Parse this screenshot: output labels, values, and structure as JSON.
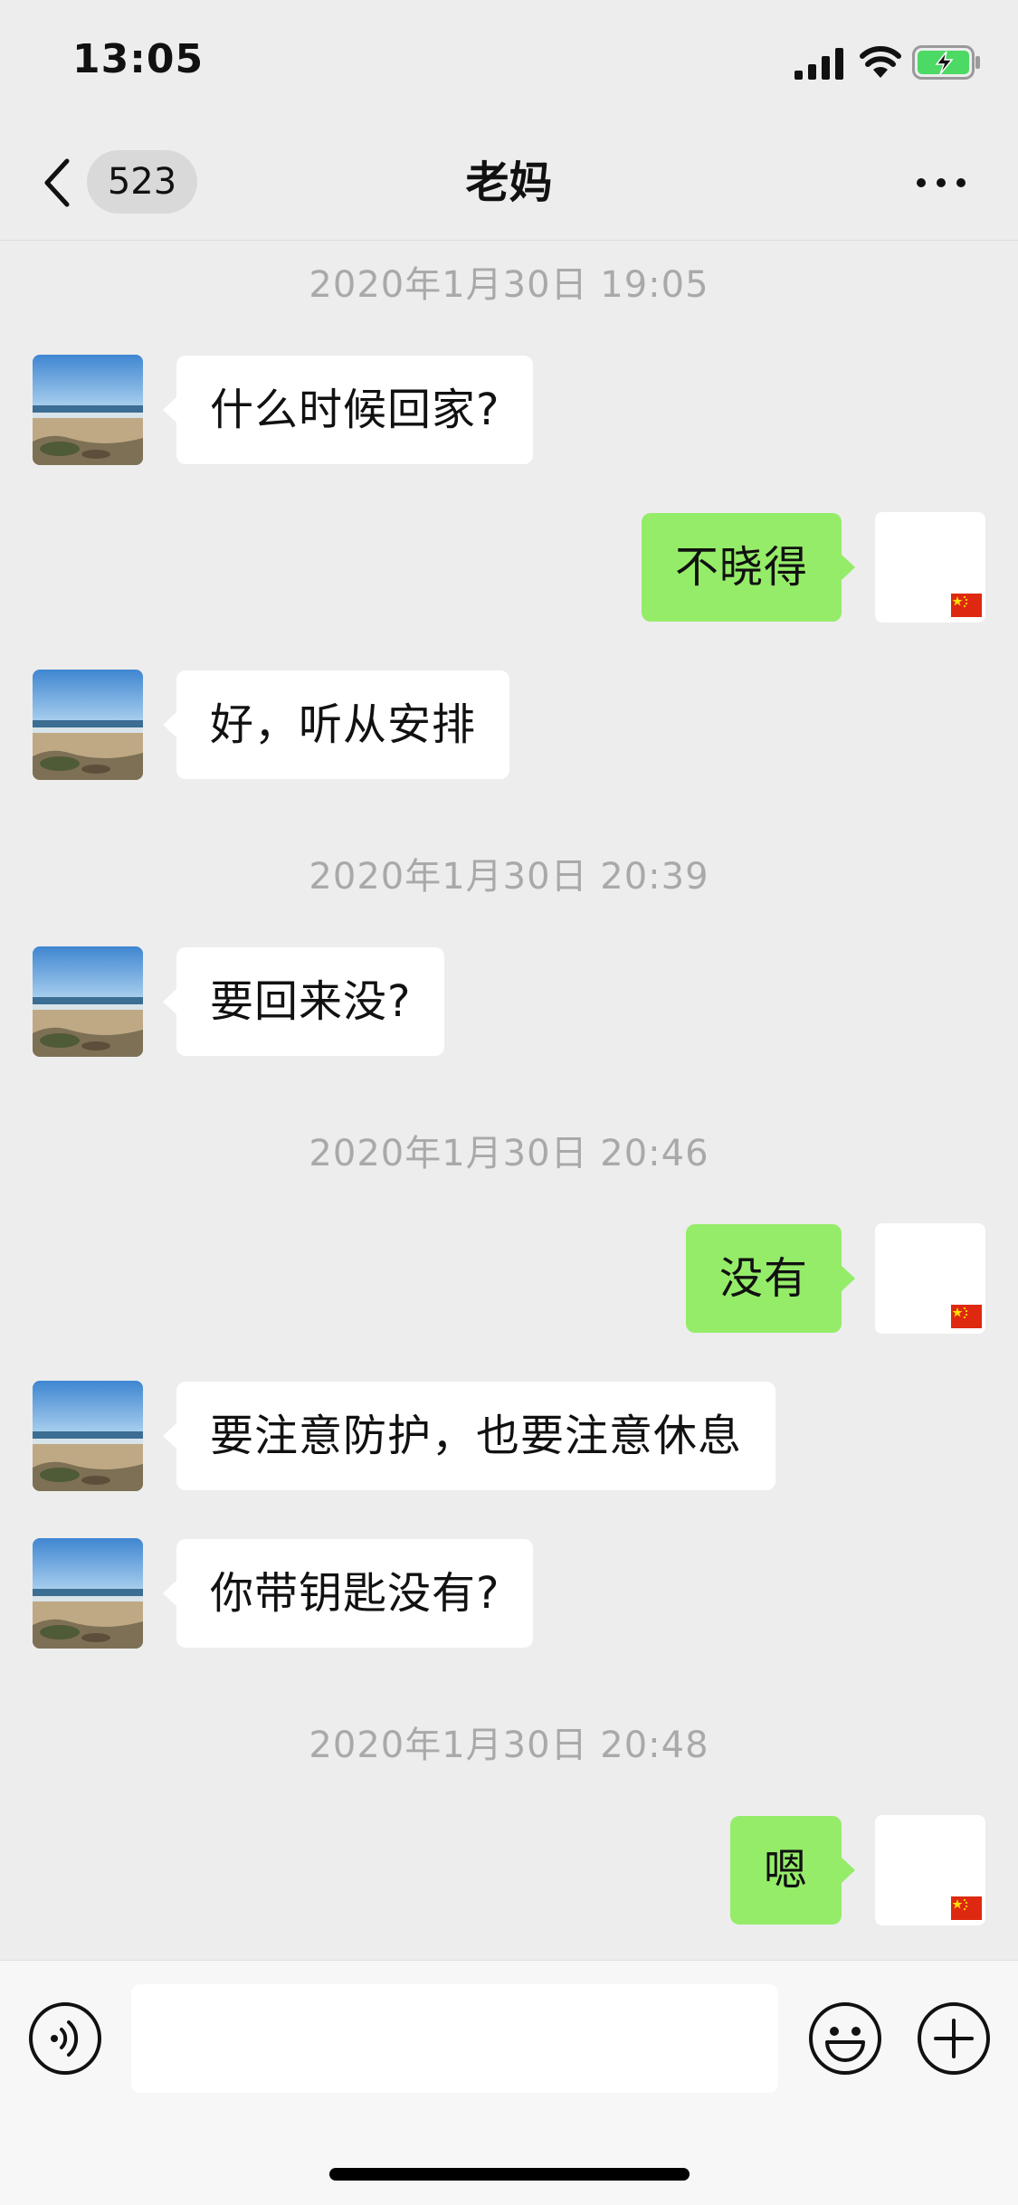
{
  "status_bar": {
    "time": "13:05",
    "icons": [
      "signal-icon",
      "wifi-icon",
      "battery-charging-icon"
    ]
  },
  "nav": {
    "back_icon": "chevron-left-icon",
    "unread_count": "523",
    "title": "老妈",
    "more_icon": "more-dots-icon"
  },
  "conversation": {
    "timestamps": [
      "2020年1月30日 19:05",
      "2020年1月30日 20:39",
      "2020年1月30日 20:46",
      "2020年1月30日 20:48"
    ],
    "messages": [
      {
        "from": "mom",
        "text": "什么时候回家?"
      },
      {
        "from": "me",
        "text": "不晓得"
      },
      {
        "from": "mom",
        "text": "好，听从安排"
      },
      {
        "from": "mom",
        "text": "要回来没?"
      },
      {
        "from": "me",
        "text": "没有"
      },
      {
        "from": "mom",
        "text": "要注意防护，也要注意休息"
      },
      {
        "from": "mom",
        "text": "你带钥匙没有?"
      },
      {
        "from": "me",
        "text": "嗯"
      }
    ]
  },
  "input_bar": {
    "placeholder": "",
    "icons": [
      "voice-icon",
      "emoji-icon",
      "plus-icon"
    ]
  },
  "colors": {
    "background": "#ededed",
    "outgoing_bubble": "#95ec69",
    "incoming_bubble": "#ffffff",
    "timestamp_text": "#a9a9a9"
  }
}
